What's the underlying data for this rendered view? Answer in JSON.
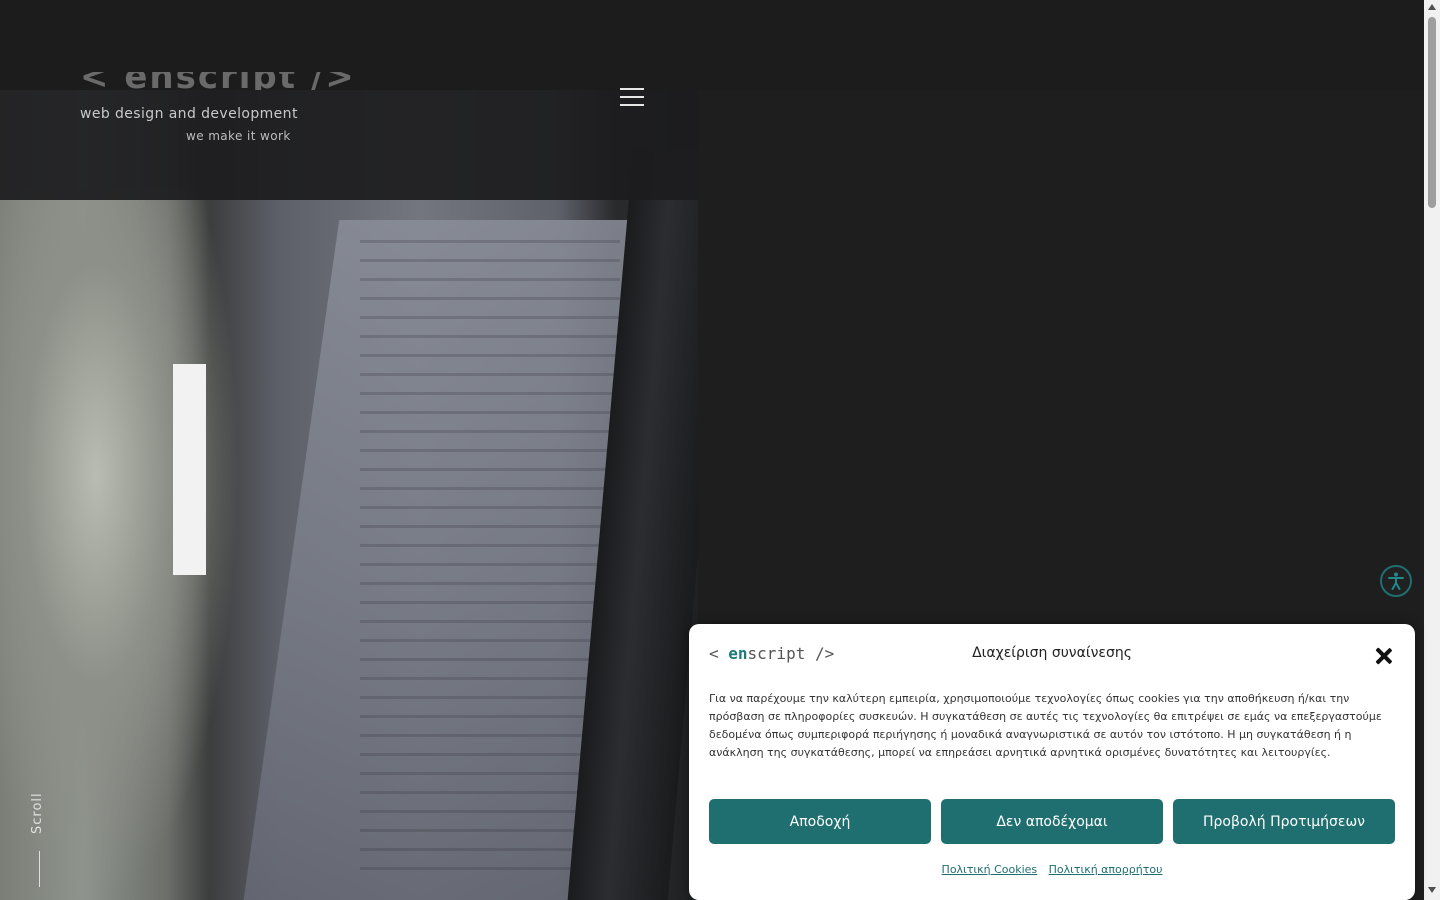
{
  "site": {
    "logo_text": "< enscript />",
    "tagline": "web design and development",
    "subtagline": "we make it work",
    "scroll_label": "Scroll"
  },
  "icons": {
    "menu": "hamburger-icon",
    "accessibility": "accessibility-icon",
    "close": "close-icon"
  },
  "colors": {
    "accent": "#1f6f70",
    "background": "#1e1e1f",
    "modal_bg": "#ffffff"
  },
  "consent": {
    "brand_prefix": "< ",
    "brand_en": "en",
    "brand_rest": "script />",
    "title": "Διαχείριση συναίνεσης",
    "body": "Για να παρέχουμε την καλύτερη εμπειρία, χρησιμοποιούμε τεχνολογίες όπως cookies για την αποθήκευση ή/και την πρόσβαση σε πληροφορίες συσκευών. Η συγκατάθεση σε αυτές τις τεχνολογίες θα επιτρέψει σε εμάς να επεξεργαστούμε δεδομένα όπως συμπεριφορά περιήγησης ή μοναδικά αναγνωριστικά σε αυτόν τον ιστότοπο. Η μη συγκατάθεση ή η ανάκληση της συγκατάθεσης, μπορεί να επηρεάσει αρνητικά αρνητικά ορισμένες δυνατότητες και λειτουργίες.",
    "buttons": {
      "accept": "Αποδοχή",
      "deny": "Δεν αποδέχομαι",
      "preferences": "Προβολή Προτιμήσεων"
    },
    "links": {
      "cookie_policy": "Πολιτική Cookies",
      "privacy_policy": "Πολιτική απορρήτου"
    }
  }
}
